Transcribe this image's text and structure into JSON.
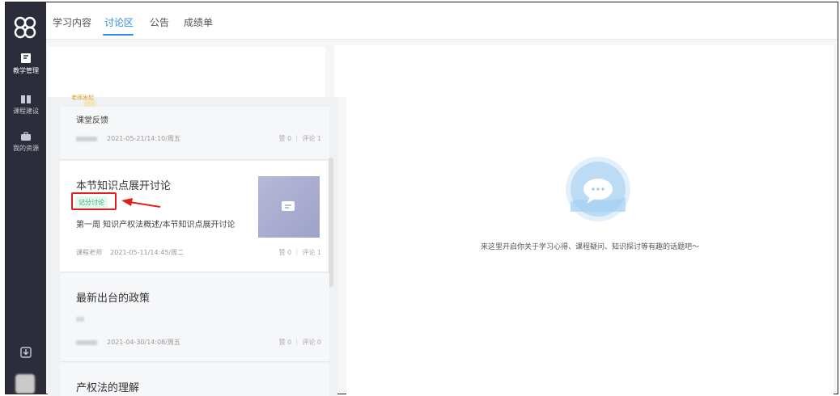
{
  "sidebar": {
    "items": [
      {
        "label": "教学管理"
      },
      {
        "label": "课程建设"
      },
      {
        "label": "我的资源"
      }
    ]
  },
  "tabs": [
    {
      "label": "学习内容"
    },
    {
      "label": "讨论区"
    },
    {
      "label": "公告"
    },
    {
      "label": "成绩单"
    }
  ],
  "topics": [
    {
      "tag": "老师发起",
      "title": "课堂反馈",
      "date": "2021-05-21/14:10/周五",
      "stats": "赞 0 ｜ 评论 1"
    },
    {
      "title": "本节知识点展开讨论",
      "badge": "记分讨论",
      "subtitle": "第一周 知识产权法概述/本节知识点展开讨论",
      "author": "课程老师",
      "date": "2021-05-11/14:45/周二",
      "stats": "赞 0 ｜ 评论 1"
    },
    {
      "title": "最新出台的政策",
      "date": "2021-04-30/14:08/周五",
      "stats": "赞 0 ｜ 评论 0"
    },
    {
      "title": "产权法的理解"
    }
  ],
  "empty_state": {
    "icon": "chat-bubble-icon",
    "text": "来这里开启你关于学习心得、课程疑问、知识探讨等有趣的话题吧～"
  },
  "colors": {
    "accent": "#2f8cf0",
    "sidebar": "#2b2d3a",
    "badge_green": "#2bb673",
    "annotation_red": "#e02020"
  }
}
